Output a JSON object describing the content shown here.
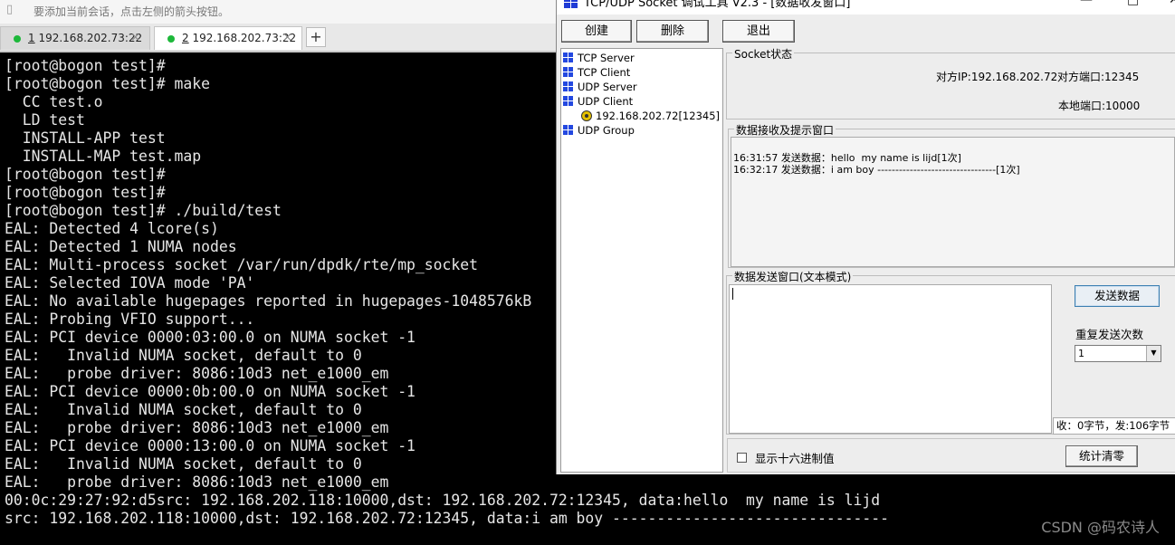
{
  "hint_bar": {
    "text": "要添加当前会话，点击左侧的箭头按钮。"
  },
  "tabs": [
    {
      "number": "1",
      "label": " 192.168.202.73:22",
      "close": "×"
    },
    {
      "number": "2",
      "label": " 192.168.202.73:22",
      "close": "×"
    }
  ],
  "add_tab": "+",
  "terminal": {
    "lines": [
      "[root@bogon test]#",
      "[root@bogon test]# make",
      "  CC test.o",
      "  LD test",
      "  INSTALL-APP test",
      "  INSTALL-MAP test.map",
      "[root@bogon test]#",
      "[root@bogon test]#",
      "[root@bogon test]# ./build/test",
      "EAL: Detected 4 lcore(s)",
      "EAL: Detected 1 NUMA nodes",
      "EAL: Multi-process socket /var/run/dpdk/rte/mp_socket",
      "EAL: Selected IOVA mode 'PA'",
      "EAL: No available hugepages reported in hugepages-1048576kB",
      "EAL: Probing VFIO support...",
      "EAL: PCI device 0000:03:00.0 on NUMA socket -1",
      "EAL:   Invalid NUMA socket, default to 0",
      "EAL:   probe driver: 8086:10d3 net_e1000_em",
      "EAL: PCI device 0000:0b:00.0 on NUMA socket -1",
      "EAL:   Invalid NUMA socket, default to 0",
      "EAL:   probe driver: 8086:10d3 net_e1000_em",
      "EAL: PCI device 0000:13:00.0 on NUMA socket -1",
      "EAL:   Invalid NUMA socket, default to 0",
      "EAL:   probe driver: 8086:10d3 net_e1000_em",
      "00:0c:29:27:92:d5src: 192.168.202.118:10000,dst: 192.168.202.72:12345, data:hello  my name is lijd",
      "src: 192.168.202.118:10000,dst: 192.168.202.72:12345, data:i am boy -------------------------------"
    ],
    "watermark": "CSDN @码农诗人"
  },
  "tool": {
    "title": "TCP/UDP Socket 调试工具 V2.3 - [数据收发窗口]",
    "window_buttons": {
      "minimize": "—",
      "maximize": "□",
      "close": "✕"
    },
    "toolbar": {
      "create": "创建",
      "delete": "删除",
      "exit": "退出"
    },
    "tree": {
      "tcp_server": "TCP Server",
      "tcp_client": "TCP Client",
      "udp_server": "UDP Server",
      "udp_client": "UDP Client",
      "udp_client_child": "192.168.202.72[12345]",
      "udp_group": "UDP Group"
    },
    "socket_status": {
      "legend": "Socket状态",
      "remote_ip": "对方IP:192.168.202.72",
      "remote_port": "对方端口:12345",
      "local_port": "本地端口:10000"
    },
    "receive": {
      "legend": "数据接收及提示窗口",
      "messages": [
        "16:31:57 发送数据：hello  my name is lijd[1次]",
        "16:32:17 发送数据：i am boy ---------------------------------[1次]"
      ]
    },
    "send": {
      "legend": "数据发送窗口(文本模式)",
      "value": "",
      "send_button": "发送数据",
      "repeat_label": "重复发送次数",
      "repeat_value": "1",
      "stats": "收：0字节，发:106字节"
    },
    "hex_label": "显示十六进制值",
    "hex_checked": false,
    "clear_button": "统计清零"
  }
}
